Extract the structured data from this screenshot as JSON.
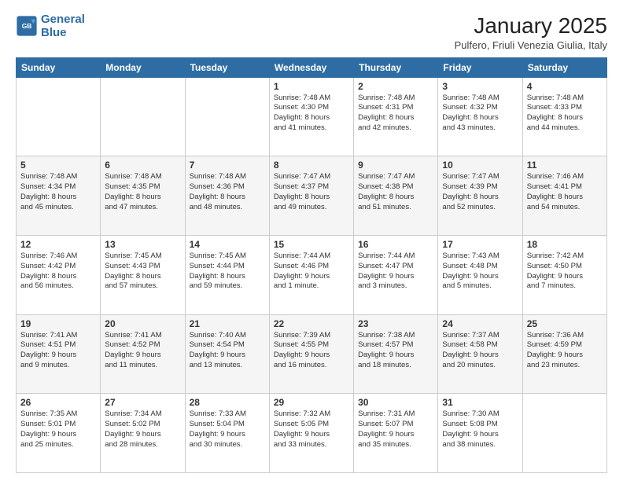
{
  "logo": {
    "line1": "General",
    "line2": "Blue"
  },
  "title": "January 2025",
  "location": "Pulfero, Friuli Venezia Giulia, Italy",
  "days_of_week": [
    "Sunday",
    "Monday",
    "Tuesday",
    "Wednesday",
    "Thursday",
    "Friday",
    "Saturday"
  ],
  "weeks": [
    [
      {
        "day": "",
        "content": ""
      },
      {
        "day": "",
        "content": ""
      },
      {
        "day": "",
        "content": ""
      },
      {
        "day": "1",
        "content": "Sunrise: 7:48 AM\nSunset: 4:30 PM\nDaylight: 8 hours\nand 41 minutes."
      },
      {
        "day": "2",
        "content": "Sunrise: 7:48 AM\nSunset: 4:31 PM\nDaylight: 8 hours\nand 42 minutes."
      },
      {
        "day": "3",
        "content": "Sunrise: 7:48 AM\nSunset: 4:32 PM\nDaylight: 8 hours\nand 43 minutes."
      },
      {
        "day": "4",
        "content": "Sunrise: 7:48 AM\nSunset: 4:33 PM\nDaylight: 8 hours\nand 44 minutes."
      }
    ],
    [
      {
        "day": "5",
        "content": "Sunrise: 7:48 AM\nSunset: 4:34 PM\nDaylight: 8 hours\nand 45 minutes."
      },
      {
        "day": "6",
        "content": "Sunrise: 7:48 AM\nSunset: 4:35 PM\nDaylight: 8 hours\nand 47 minutes."
      },
      {
        "day": "7",
        "content": "Sunrise: 7:48 AM\nSunset: 4:36 PM\nDaylight: 8 hours\nand 48 minutes."
      },
      {
        "day": "8",
        "content": "Sunrise: 7:47 AM\nSunset: 4:37 PM\nDaylight: 8 hours\nand 49 minutes."
      },
      {
        "day": "9",
        "content": "Sunrise: 7:47 AM\nSunset: 4:38 PM\nDaylight: 8 hours\nand 51 minutes."
      },
      {
        "day": "10",
        "content": "Sunrise: 7:47 AM\nSunset: 4:39 PM\nDaylight: 8 hours\nand 52 minutes."
      },
      {
        "day": "11",
        "content": "Sunrise: 7:46 AM\nSunset: 4:41 PM\nDaylight: 8 hours\nand 54 minutes."
      }
    ],
    [
      {
        "day": "12",
        "content": "Sunrise: 7:46 AM\nSunset: 4:42 PM\nDaylight: 8 hours\nand 56 minutes."
      },
      {
        "day": "13",
        "content": "Sunrise: 7:45 AM\nSunset: 4:43 PM\nDaylight: 8 hours\nand 57 minutes."
      },
      {
        "day": "14",
        "content": "Sunrise: 7:45 AM\nSunset: 4:44 PM\nDaylight: 8 hours\nand 59 minutes."
      },
      {
        "day": "15",
        "content": "Sunrise: 7:44 AM\nSunset: 4:46 PM\nDaylight: 9 hours\nand 1 minute."
      },
      {
        "day": "16",
        "content": "Sunrise: 7:44 AM\nSunset: 4:47 PM\nDaylight: 9 hours\nand 3 minutes."
      },
      {
        "day": "17",
        "content": "Sunrise: 7:43 AM\nSunset: 4:48 PM\nDaylight: 9 hours\nand 5 minutes."
      },
      {
        "day": "18",
        "content": "Sunrise: 7:42 AM\nSunset: 4:50 PM\nDaylight: 9 hours\nand 7 minutes."
      }
    ],
    [
      {
        "day": "19",
        "content": "Sunrise: 7:41 AM\nSunset: 4:51 PM\nDaylight: 9 hours\nand 9 minutes."
      },
      {
        "day": "20",
        "content": "Sunrise: 7:41 AM\nSunset: 4:52 PM\nDaylight: 9 hours\nand 11 minutes."
      },
      {
        "day": "21",
        "content": "Sunrise: 7:40 AM\nSunset: 4:54 PM\nDaylight: 9 hours\nand 13 minutes."
      },
      {
        "day": "22",
        "content": "Sunrise: 7:39 AM\nSunset: 4:55 PM\nDaylight: 9 hours\nand 16 minutes."
      },
      {
        "day": "23",
        "content": "Sunrise: 7:38 AM\nSunset: 4:57 PM\nDaylight: 9 hours\nand 18 minutes."
      },
      {
        "day": "24",
        "content": "Sunrise: 7:37 AM\nSunset: 4:58 PM\nDaylight: 9 hours\nand 20 minutes."
      },
      {
        "day": "25",
        "content": "Sunrise: 7:36 AM\nSunset: 4:59 PM\nDaylight: 9 hours\nand 23 minutes."
      }
    ],
    [
      {
        "day": "26",
        "content": "Sunrise: 7:35 AM\nSunset: 5:01 PM\nDaylight: 9 hours\nand 25 minutes."
      },
      {
        "day": "27",
        "content": "Sunrise: 7:34 AM\nSunset: 5:02 PM\nDaylight: 9 hours\nand 28 minutes."
      },
      {
        "day": "28",
        "content": "Sunrise: 7:33 AM\nSunset: 5:04 PM\nDaylight: 9 hours\nand 30 minutes."
      },
      {
        "day": "29",
        "content": "Sunrise: 7:32 AM\nSunset: 5:05 PM\nDaylight: 9 hours\nand 33 minutes."
      },
      {
        "day": "30",
        "content": "Sunrise: 7:31 AM\nSunset: 5:07 PM\nDaylight: 9 hours\nand 35 minutes."
      },
      {
        "day": "31",
        "content": "Sunrise: 7:30 AM\nSunset: 5:08 PM\nDaylight: 9 hours\nand 38 minutes."
      },
      {
        "day": "",
        "content": ""
      }
    ]
  ]
}
